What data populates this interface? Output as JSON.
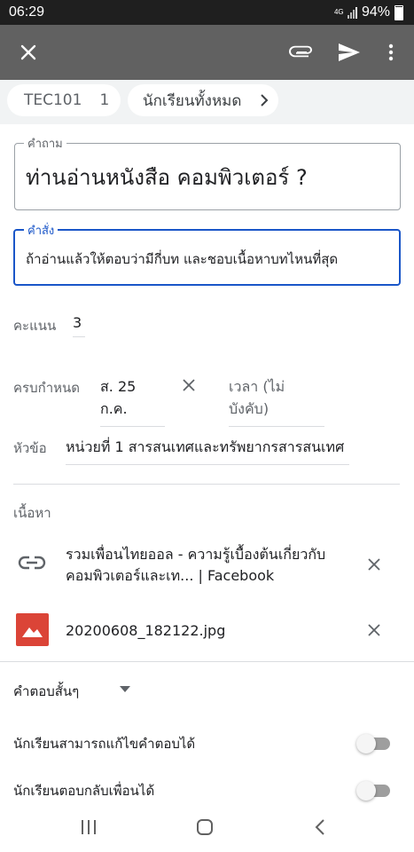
{
  "status_bar": {
    "time": "06:29",
    "network": "4G",
    "battery": "94%"
  },
  "app_bar": {
    "close_icon": "close-icon",
    "attach_icon": "attachment-icon",
    "send_icon": "send-icon",
    "more_icon": "more-vert-icon"
  },
  "chips": {
    "class_code": "TEC101",
    "class_count": "1",
    "audience": "นักเรียนทั้งหมด"
  },
  "question": {
    "label": "คำถาม",
    "value": "ท่านอ่านหนังสือ คอมพิวเตอร์ ?"
  },
  "instructions": {
    "label": "คำสั่ง",
    "value": "ถ้าอ่านแล้วให้ตอบว่ามีกี่บท และชอบเนื้อหาบทไหนที่สุด"
  },
  "points": {
    "label": "คะแนน",
    "value": "3"
  },
  "due": {
    "label": "ครบกำหนด",
    "date": "ส. 25 ก.ค.",
    "time_placeholder": "เวลา (ไม่บังคับ)"
  },
  "topic": {
    "label": "หัวข้อ",
    "value": "หน่วยที่ 1 สารสนเทศและทรัพยากรสารสนเทศ"
  },
  "content": {
    "label": "เนื้อหา",
    "attachments": [
      {
        "icon": "link-icon",
        "title": "รวมเพื่อนไทยออล - ความรู้เบื้องต้นเกี่ยวกับ คอมพิวเตอร์และเท... | Facebook"
      },
      {
        "icon": "image-icon",
        "title": "20200608_182122.jpg",
        "color": "#db4437"
      }
    ]
  },
  "question_type": {
    "value": "คำตอบสั้นๆ"
  },
  "toggles": [
    {
      "label": "นักเรียนสามารถแก้ไขคำตอบได้",
      "on": false
    },
    {
      "label": "นักเรียนตอบกลับเพื่อนได้",
      "on": false
    }
  ],
  "nav": {
    "recents_icon": "recents-icon",
    "home_icon": "home-icon",
    "back_icon": "back-icon"
  },
  "colors": {
    "app_bar": "#616161",
    "accent": "#1a56c8",
    "image_icon": "#db4437"
  }
}
